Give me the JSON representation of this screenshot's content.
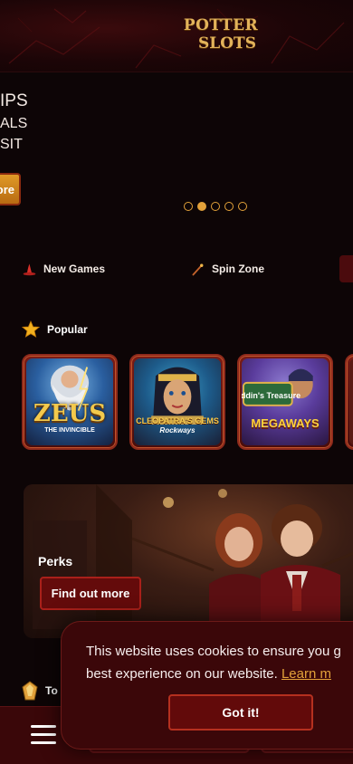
{
  "header": {
    "logo_line1": "POTTER",
    "logo_line2": "SLOTS"
  },
  "hero": {
    "line1": "IPS",
    "line2": "ALS",
    "line3": "SIT",
    "button_label": "ore",
    "slide_count": 5,
    "active_slide": 2
  },
  "categories": [
    {
      "label": "New Games",
      "icon": "wizard-hat-icon"
    },
    {
      "label": "Spin Zone",
      "icon": "magic-wand-icon"
    }
  ],
  "popular": {
    "label": "Popular",
    "icon": "star-icon",
    "games": [
      {
        "title": "ZEUS",
        "subtitle": "THE INVINCIBLE"
      },
      {
        "title": "CLEOPATRA'S GEMS",
        "subtitle": "Rockways"
      },
      {
        "title": "Aladdin's Treasure",
        "subtitle": "MEGAWAYS"
      }
    ]
  },
  "perks": {
    "title": "Perks",
    "button_label": "Find out more"
  },
  "top_section": {
    "label": "To",
    "icon": "gem-icon"
  },
  "cookie_banner": {
    "text_line1": "This website uses cookies to ensure you g",
    "text_line2": "best experience on our website.",
    "link_label": "Learn m",
    "button_label": "Got it!"
  },
  "colors": {
    "accent_gold": "#e2a13a",
    "deep_red": "#620a0a",
    "background": "#0d0506"
  }
}
